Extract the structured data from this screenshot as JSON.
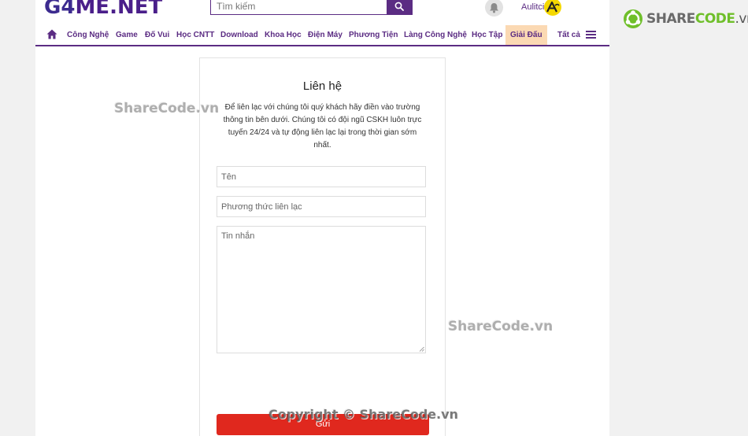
{
  "header": {
    "logo": {
      "part1": "G4",
      "part2": "ME.NET"
    },
    "search_placeholder": "Tìm kiếm",
    "user_name": "Aulitci"
  },
  "nav": {
    "items": [
      {
        "label": "Công Nghệ"
      },
      {
        "label": "Game"
      },
      {
        "label": "Đố Vui"
      },
      {
        "label": "Học CNTT"
      },
      {
        "label": "Download"
      },
      {
        "label": "Khoa Học"
      },
      {
        "label": "Điện Máy"
      },
      {
        "label": "Phương Tiện"
      },
      {
        "label": "Làng Công Nghệ"
      },
      {
        "label": "Học Tập"
      },
      {
        "label": "Giải Đấu"
      },
      {
        "label": "Tất cả"
      }
    ],
    "active_index": 10
  },
  "contact": {
    "title": "Liên hệ",
    "description": "Để liên lạc với chúng tôi quý khách hãy điền vào trường thông tin bên dưới. Chúng tôi có đội ngũ CSKH luôn trực tuyến 24/24 và tự động liên lạc lại trong thời gian sớm nhất.",
    "name_placeholder": "Tên",
    "method_placeholder": "Phương thức liên lạc",
    "message_placeholder": "Tin nhắn",
    "submit_label": "Gửi"
  },
  "watermarks": {
    "wm1": "ShareCode.vn",
    "wm2": "ShareCode.vn",
    "copyright": "Copyright © ShareCode.vn",
    "brand_main": "SHARE",
    "brand_accent": "CODE",
    "brand_tld": ".vn"
  },
  "colors": {
    "brand_purple": "#5b2c83",
    "submit_red": "#e0281e",
    "active_tab_bg": "#fbd9b3",
    "avatar_yellow": "#f5d800"
  }
}
